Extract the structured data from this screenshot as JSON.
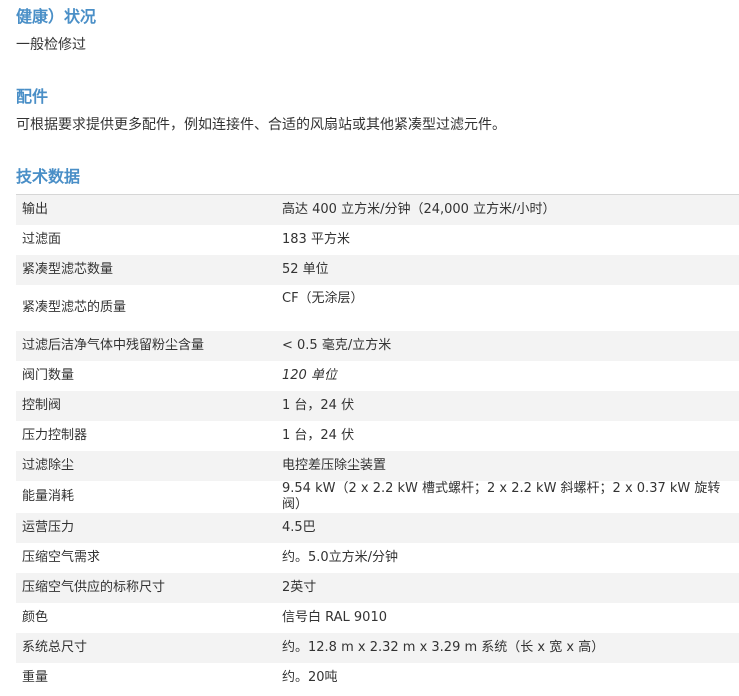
{
  "health": {
    "title": "健康）状况",
    "text": "一般检修过"
  },
  "accessories": {
    "title": "配件",
    "text": "可根据要求提供更多配件，例如连接件、合适的风扇站或其他紧凑型过滤元件。"
  },
  "tech": {
    "title": "技术数据",
    "rows": [
      {
        "label": "输出",
        "value": "高达 400 立方米/分钟（24,000 立方米/小时）"
      },
      {
        "label": "过滤面",
        "value": "183 平方米"
      },
      {
        "label": "紧凑型滤芯数量",
        "value": "52 单位"
      },
      {
        "label": "紧凑型滤芯的质量",
        "value": "CF（无涂层）"
      },
      {
        "label": "过滤后洁净气体中残留粉尘含量",
        "value": "< 0.5 毫克/立方米"
      },
      {
        "label": "阀门数量",
        "value": "120 单位"
      },
      {
        "label": "控制阀",
        "value": "1 台，24 伏"
      },
      {
        "label": "压力控制器",
        "value": "1 台，24 伏"
      },
      {
        "label": "过滤除尘",
        "value": "电控差压除尘装置"
      },
      {
        "label": "能量消耗",
        "value": "9.54 kW（2 x 2.2 kW 槽式螺杆；2 x 2.2 kW 斜螺杆；2 x 0.37 kW 旋转阀）"
      },
      {
        "label": "运营压力",
        "value": "4.5巴"
      },
      {
        "label": "压缩空气需求",
        "value": "约。5.0立方米/分钟"
      },
      {
        "label": "压缩空气供应的标称尺寸",
        "value": "2英寸"
      },
      {
        "label": "颜色",
        "value": "信号白 RAL 9010"
      },
      {
        "label": "系统总尺寸",
        "value": "约。12.8 m x 2.32 m x 3.29 m 系统（长 x 宽 x 高）"
      },
      {
        "label": "重量",
        "value": "约。20吨"
      }
    ]
  }
}
